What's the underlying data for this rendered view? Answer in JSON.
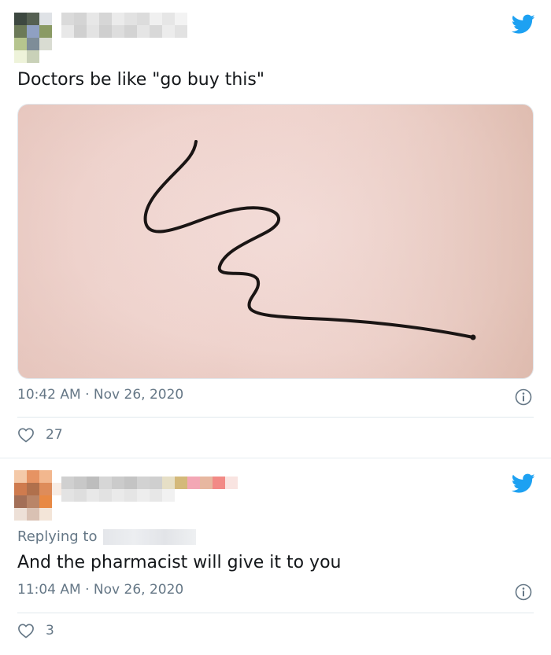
{
  "tweets": [
    {
      "text": "Doctors be like \"go buy this\"",
      "time": "10:42 AM",
      "date": "Nov 26, 2020",
      "likes": "27",
      "has_media": true
    },
    {
      "replying_label": "Replying to",
      "text": "And the pharmacist will give it to you",
      "time": "11:04 AM",
      "date": "Nov 26, 2020",
      "likes": "3"
    }
  ],
  "colors": {
    "twitter_blue": "#1da1f2",
    "meta_gray": "#657786",
    "divider": "#e1e8ed"
  },
  "icons": {
    "brand": "twitter-bird-icon",
    "info": "info-icon",
    "like": "heart-icon"
  }
}
